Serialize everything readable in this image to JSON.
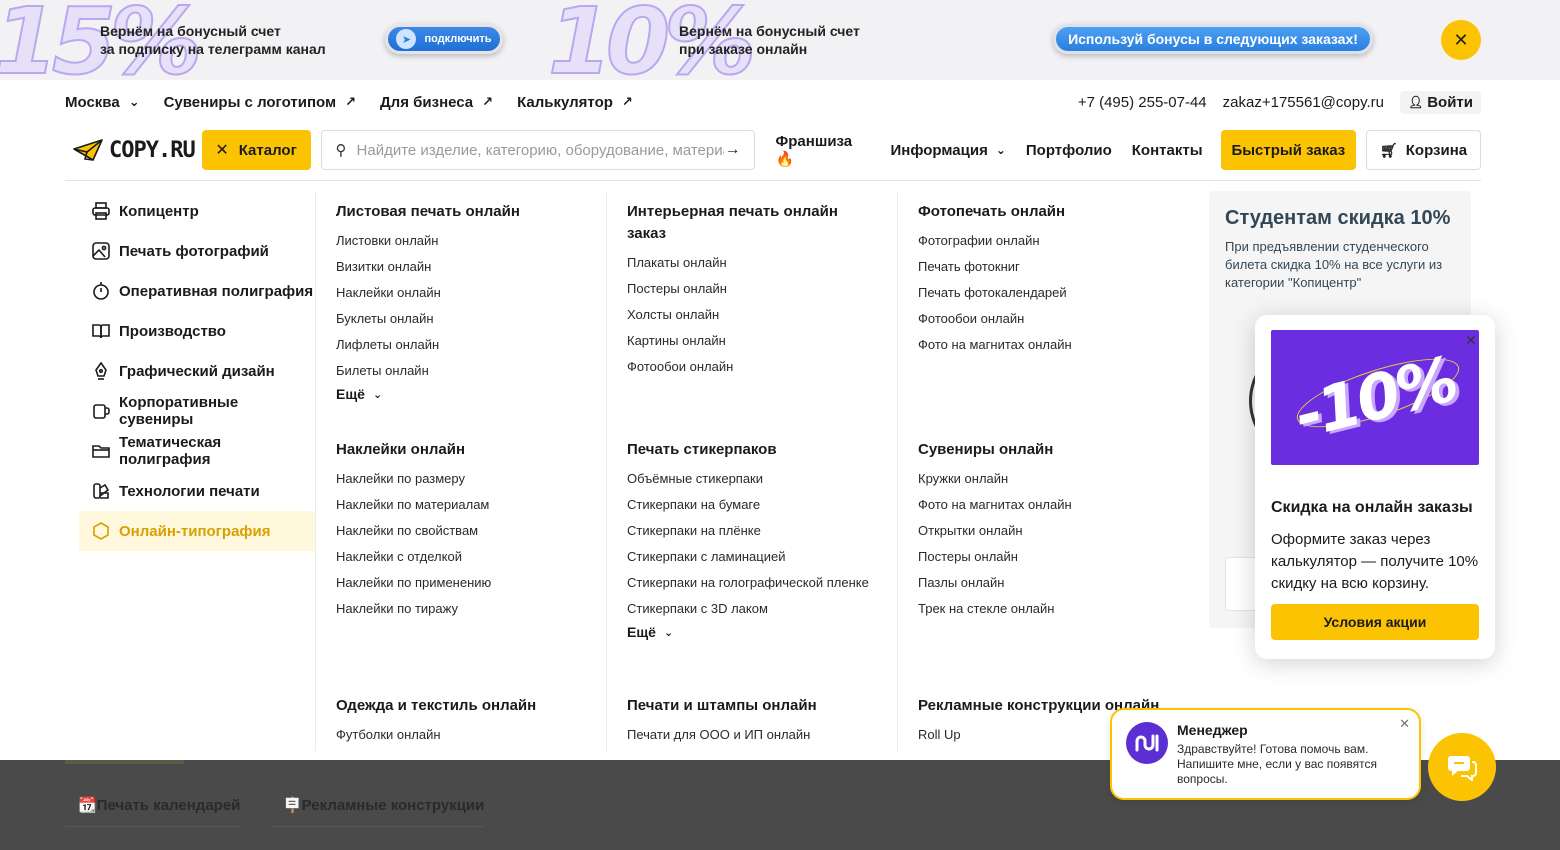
{
  "promo": {
    "left_big": "15%",
    "left_text_line1": "Вернём на бонусный счет",
    "left_text_line2": "за подписку на телеграмм канал",
    "connect_label": "подключить",
    "mid_big": "10%",
    "mid_text_line1": "Вернём на бонусный счет",
    "mid_text_line2": "при заказе онлайн",
    "bonus_label": "Используй бонусы в следующих заказах!",
    "accent": "#fcc303"
  },
  "topnav": {
    "city": "Москва",
    "links": [
      "Сувениры с логотипом",
      "Для бизнеса",
      "Калькулятор"
    ],
    "phone": "+7 (495) 255-07-44",
    "email": "zakaz+175561@copy.ru",
    "login": "Войти"
  },
  "header": {
    "logo": "COPY.RU",
    "catalog_label": "Каталог",
    "search_placeholder": "Найдите изделие, категорию, оборудование, материал",
    "nav": {
      "franchise": "Франшиза 🔥",
      "info": "Информация",
      "portfolio": "Портфолио",
      "contacts": "Контакты"
    },
    "fast_order": "Быстрый заказ",
    "cart": "Корзина"
  },
  "categories": [
    {
      "label": "Копицентр",
      "icon": "printer-icon"
    },
    {
      "label": "Печать фотографий",
      "icon": "photo-icon"
    },
    {
      "label": "Оперативная полиграфия",
      "icon": "stopwatch-icon"
    },
    {
      "label": "Производство",
      "icon": "book-icon"
    },
    {
      "label": "Графический дизайн",
      "icon": "pen-nib-icon"
    },
    {
      "label": "Корпоративные сувениры",
      "icon": "mug-icon"
    },
    {
      "label": "Тематическая полиграфия",
      "icon": "folder-icon"
    },
    {
      "label": "Технологии печати",
      "icon": "palette-icon"
    },
    {
      "label": "Онлайн-типография",
      "icon": "hexagon-icon"
    }
  ],
  "groups": {
    "sheet": {
      "title": "Листовая печать онлайн",
      "items": [
        "Листовки онлайн",
        "Визитки онлайн",
        "Наклейки онлайн",
        "Буклеты онлайн",
        "Лифлеты онлайн",
        "Билеты онлайн"
      ],
      "more": "Ещё"
    },
    "interior": {
      "title": "Интерьерная печать онлайн заказ",
      "items": [
        "Плакаты онлайн",
        "Постеры онлайн",
        "Холсты онлайн",
        "Картины онлайн",
        "Фотообои онлайн"
      ]
    },
    "photo": {
      "title": "Фотопечать онлайн",
      "items": [
        "Фотографии онлайн",
        "Печать фотокниг",
        "Печать фотокалендарей",
        "Фотообои онлайн",
        "Фото на магнитах онлайн"
      ]
    },
    "stickers": {
      "title": "Наклейки онлайн",
      "items": [
        "Наклейки по размеру",
        "Наклейки по материалам",
        "Наклейки по свойствам",
        "Наклейки с отделкой",
        "Наклейки по применению",
        "Наклейки по тиражу"
      ]
    },
    "stickerpacks": {
      "title": "Печать стикерпаков",
      "items": [
        "Объёмные стикерпаки",
        "Стикерпаки на бумаге",
        "Стикерпаки на плёнке",
        "Стикерпаки с ламинацией",
        "Стикерпаки на голографической пленке",
        "Стикерпаки с 3D лаком"
      ],
      "more": "Ещё"
    },
    "souvenirs": {
      "title": "Сувениры онлайн",
      "items": [
        "Кружки онлайн",
        "Фото на магнитах онлайн",
        "Открытки онлайн",
        "Постеры онлайн",
        "Пазлы онлайн",
        "Трек на стекле онлайн"
      ]
    },
    "clothes": {
      "title": "Одежда и текстиль онлайн",
      "items": [
        "Футболки онлайн"
      ]
    },
    "stamps": {
      "title": "Печати и штампы онлайн",
      "items": [
        "Печати для ООО и ИП онлайн"
      ]
    },
    "ads": {
      "title": "Рекламные конструкции онлайн",
      "items": [
        "Roll Up"
      ]
    }
  },
  "student": {
    "title": "Студентам скидка 10%",
    "text": "При предъявлении студенческого билета скидка 10% на все услуги из категории \"Копицентр\""
  },
  "popup": {
    "art_text": "-10%",
    "title": "Скидка на онлайн заказы",
    "text": "Оформите заказ через калькулятор — получите 10% скидку на всю корзину.",
    "button": "Условия акции"
  },
  "background_chips": [
    "📆Печать календарей",
    "🪧Рекламные конструкции"
  ],
  "chat": {
    "name": "Менеджер",
    "message": "Здравствуйте! Готова помочь вам. Напишите мне, если у вас появятся вопросы."
  }
}
